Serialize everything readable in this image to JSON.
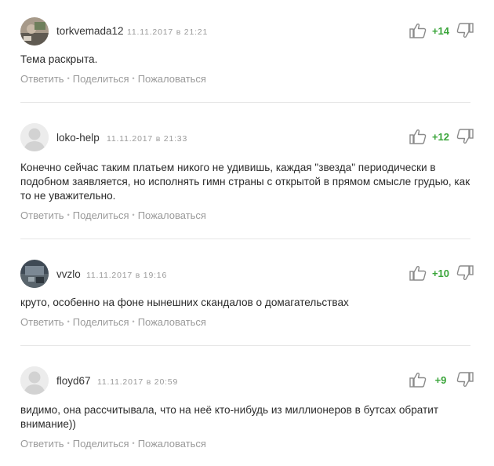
{
  "icons": {
    "like": "thumbs-up-icon",
    "dislike": "thumbs-down-icon"
  },
  "colors": {
    "positive_score": "#3aa53a",
    "muted": "#9a9a9a",
    "text": "#2b2b2b"
  },
  "actions": {
    "reply": "Ответить",
    "share": "Поделиться",
    "report": "Пожаловаться"
  },
  "comments": [
    {
      "author": "torkvemada12",
      "date": "11.11.2017 в 21:21",
      "score": "+14",
      "text": "Тема раскрыта.",
      "avatar": "photo"
    },
    {
      "author": "loko-help",
      "date": "11.11.2017 в 21:33",
      "score": "+12",
      "text": "Конечно сейчас таким платьем никого не удивишь, каждая \"звезда\" периодически в подобном заявляется, но исполнять гимн страны с открытой в прямом смысле грудью, как то не уважительно.",
      "avatar": "placeholder"
    },
    {
      "author": "vvzlo",
      "date": "11.11.2017 в 19:16",
      "score": "+10",
      "text": "круто, особенно на фоне нынешних скандалов о домагательствах",
      "avatar": "photo"
    },
    {
      "author": "floyd67",
      "date": "11.11.2017 в 20:59",
      "score": "+9",
      "text": "видимо, она рассчитывала, что на неё кто-нибудь из миллионеров в бутсах обратит внимание))",
      "avatar": "placeholder"
    }
  ]
}
